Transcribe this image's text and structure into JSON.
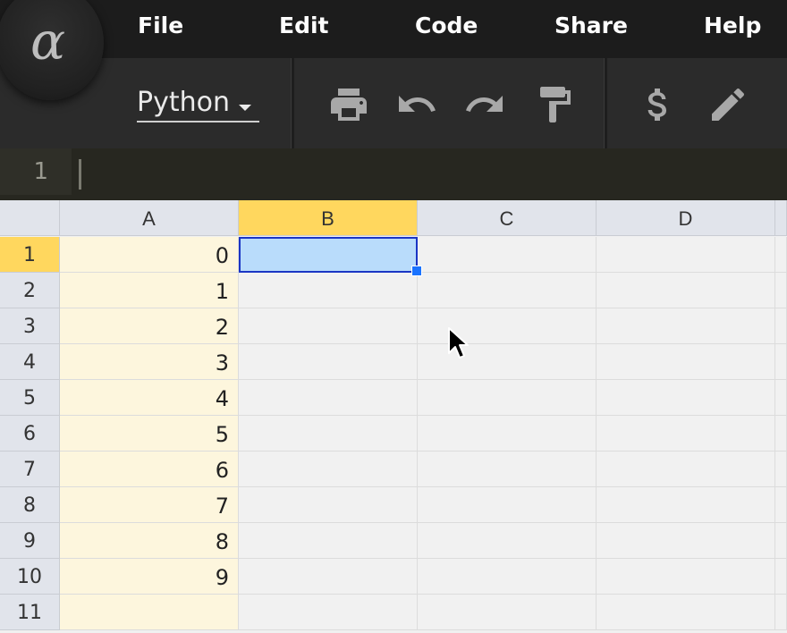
{
  "app": {
    "logo_glyph": "α",
    "menu": [
      "File",
      "Edit",
      "Code",
      "Share",
      "Help"
    ]
  },
  "toolbar": {
    "language": "Python",
    "icons": [
      "print-icon",
      "undo-icon",
      "redo-icon",
      "paint-format-icon",
      "dollar-icon",
      "pencil-icon"
    ]
  },
  "formula_bar": {
    "row_number": "1",
    "value": ""
  },
  "grid": {
    "columns": [
      "A",
      "B",
      "C",
      "D"
    ],
    "rows": [
      "1",
      "2",
      "3",
      "4",
      "5",
      "6",
      "7",
      "8",
      "9",
      "10",
      "11"
    ],
    "column_a_values": [
      "0",
      "1",
      "2",
      "3",
      "4",
      "5",
      "6",
      "7",
      "8",
      "9",
      ""
    ],
    "selected_cell": "B1"
  },
  "colors": {
    "menubar": "#1c1c1c",
    "toolbar": "#2b2b2b",
    "selected_header": "#ffd75e",
    "column_a_fill": "#fdf6dd",
    "active_cell_fill": "#b9dcfb",
    "active_cell_border": "#1a35c4"
  }
}
